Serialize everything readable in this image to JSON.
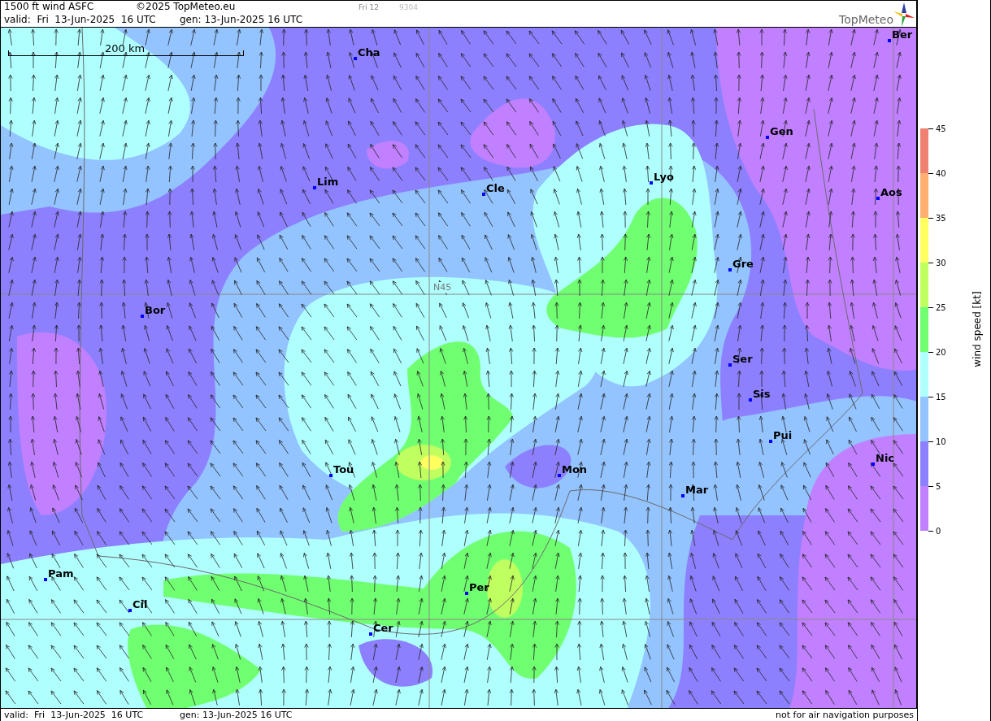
{
  "header": {
    "title": "1500 ft wind ASFC",
    "copyright": "©2025 TopMeteo.eu",
    "day_label": "Fri 12",
    "code": "9304",
    "valid": "valid:  Fri  13-Jun-2025  16 UTC",
    "generated": "gen: 13-Jun-2025 16 UTC",
    "logo_text": "TopMeteo"
  },
  "map": {
    "grid_label": "N45",
    "scale": "200 km",
    "cities": [
      {
        "name": "Cha"
      },
      {
        "name": "Ber"
      },
      {
        "name": "Gen"
      },
      {
        "name": "Lim"
      },
      {
        "name": "Cle"
      },
      {
        "name": "Lyo"
      },
      {
        "name": "Aos"
      },
      {
        "name": "Gre"
      },
      {
        "name": "Bor"
      },
      {
        "name": "Ser"
      },
      {
        "name": "Sis"
      },
      {
        "name": "Pui"
      },
      {
        "name": "Nic"
      },
      {
        "name": "Tou"
      },
      {
        "name": "Mon"
      },
      {
        "name": "Mar"
      },
      {
        "name": "Pam"
      },
      {
        "name": "Per"
      },
      {
        "name": "Cil"
      },
      {
        "name": "Cer"
      }
    ]
  },
  "legend": {
    "title": "wind speed [kt]",
    "bands": [
      {
        "color": "#f08070"
      },
      {
        "color": "#ffb070"
      },
      {
        "color": "#ffff60"
      },
      {
        "color": "#c0ff60"
      },
      {
        "color": "#70ff70"
      },
      {
        "color": "#b0ffff"
      },
      {
        "color": "#94c4ff"
      },
      {
        "color": "#8c80ff"
      },
      {
        "color": "#c080ff"
      }
    ],
    "ticks": [
      "45",
      "40",
      "35",
      "30",
      "25",
      "20",
      "15",
      "10",
      "5",
      "0"
    ]
  },
  "footer": {
    "valid": "valid:  Fri  13-Jun-2025  16 UTC",
    "generated": "gen: 13-Jun-2025 16 UTC",
    "disclaimer": "not for air navigation purposes"
  }
}
